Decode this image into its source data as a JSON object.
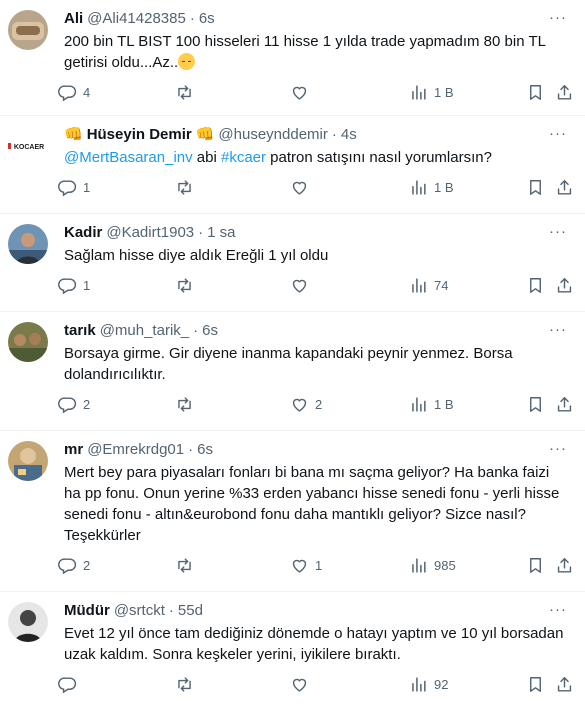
{
  "more_label": "···",
  "separator": "·",
  "colors": {
    "link": "#1d9bf0",
    "muted": "#536471",
    "text": "#0f1419",
    "divider": "#eff3f4",
    "emoji": "#ffcc4d"
  },
  "icons": {
    "reply": "speech-bubble-icon",
    "retweet": "retweet-arrows-icon",
    "like": "heart-icon",
    "views": "bar-chart-icon",
    "bookmark": "bookmark-icon",
    "share": "upload-arrow-icon",
    "emoji": "relieved-face-emoji",
    "fist": "raised-fist-emoji"
  },
  "tweets": [
    {
      "name": "Ali",
      "handle": "@Ali41428385",
      "time": "6s",
      "text": "200 bin TL BIST 100 hisseleri 11 hisse 1 yılda trade yapmadım 80 bin TL getirisi oldu...Az..",
      "replies": "4",
      "retweets": "",
      "likes": "",
      "views": "1 B"
    },
    {
      "name_emoji_left": "👊",
      "name": "Hüseyin Demir",
      "name_emoji_right": "👊",
      "handle": "@huseynddemir",
      "time": "4s",
      "mention": "@MertBasaran_inv",
      "text_mid": " abi ",
      "hashtag": "#kcaer",
      "text_end": " patron satışını nasıl yorumlarsın?",
      "avatar_text": "KOCAER",
      "replies": "1",
      "retweets": "",
      "likes": "",
      "views": "1 B"
    },
    {
      "name": "Kadir",
      "handle": "@Kadirt1903",
      "time": "1 sa",
      "text": "Sağlam hisse diye aldık Ereğli 1 yıl oldu",
      "replies": "1",
      "retweets": "",
      "likes": "",
      "views": "74"
    },
    {
      "name": "tarık",
      "handle": "@muh_tarik_",
      "time": "6s",
      "text": "Borsaya girme. Gir diyene inanma kapandaki peynir yenmez. Borsa dolandırıcılıktır.",
      "replies": "2",
      "retweets": "",
      "likes": "2",
      "views": "1 B"
    },
    {
      "name": "mr",
      "handle": "@Emrekrdg01",
      "time": "6s",
      "text": "Mert bey para piyasaları fonları bi bana mı saçma geliyor? Ha banka faizi ha pp fonu. Onun yerine %33 erden yabancı hisse senedi fonu - yerli hisse senedi fonu - altın&eurobond fonu daha mantıklı geliyor? Sizce nasıl? Teşekkürler",
      "replies": "2",
      "retweets": "",
      "likes": "1",
      "views": "985"
    },
    {
      "name": "Müdür",
      "handle": "@srtckt",
      "time": "55d",
      "text": "Evet 12 yıl önce tam dediğiniz dönemde o hatayı yaptım ve 10 yıl borsadan uzak kaldım. Sonra keşkeler yerini, iyikilere bıraktı.",
      "replies": "",
      "retweets": "",
      "likes": "",
      "views": "92"
    }
  ]
}
